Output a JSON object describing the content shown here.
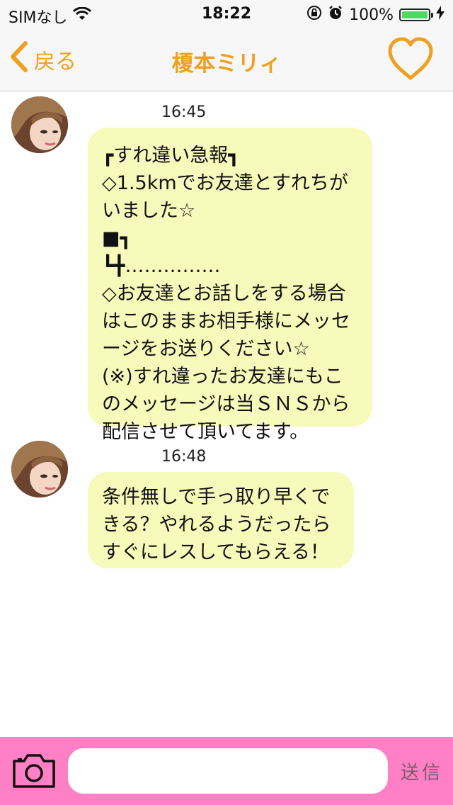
{
  "status_bar": {
    "carrier": "SIMなし",
    "time": "18:22",
    "battery_percent": "100%",
    "battery_level": 1.0
  },
  "nav": {
    "back_label": "戻る",
    "title": "榎本ミリィ",
    "accent_color": "#f0a020"
  },
  "messages": [
    {
      "time": "16:45",
      "text": "┏すれ違い急報┓\n◇1.5kmでお友達とすれちがいました☆\n■┓\n┗╋……………\n◇お友達とお話しをする場合はこのままお相手様にメッセージをお送りください☆\n(※)すれ違ったお友達にもこのメッセージは当ＳＮＳから配信させて頂いてます。"
    },
    {
      "time": "16:48",
      "text": "条件無しで手っ取り早くできる？やれるようだったらすぐにレスしてもらえる！"
    }
  ],
  "input_bar": {
    "placeholder": "",
    "value": "",
    "send_label": "送信",
    "background_color": "#ff80c4"
  },
  "icons": {
    "back": "chevron-left-icon",
    "favorite": "heart-icon",
    "camera": "camera-icon",
    "wifi": "wifi-icon",
    "lock": "orientation-lock-icon",
    "alarm": "alarm-icon",
    "charging": "charging-icon"
  }
}
